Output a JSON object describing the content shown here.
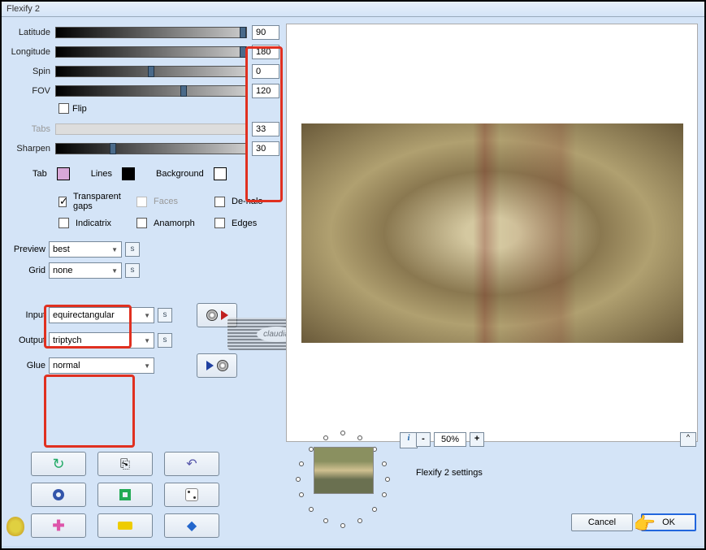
{
  "window": {
    "title": "Flexify 2"
  },
  "sliders": {
    "latitude": {
      "label": "Latitude",
      "value": "90",
      "thumb_pct": 100
    },
    "longitude": {
      "label": "Longitude",
      "value": "180",
      "thumb_pct": 100
    },
    "spin": {
      "label": "Spin",
      "value": "0",
      "thumb_pct": 50
    },
    "fov": {
      "label": "FOV",
      "value": "120",
      "thumb_pct": 67
    },
    "tabs": {
      "label": "Tabs",
      "value": "33",
      "thumb_pct": 33,
      "disabled": true
    },
    "sharpen": {
      "label": "Sharpen",
      "value": "30",
      "thumb_pct": 30
    }
  },
  "flip": {
    "label": "Flip",
    "checked": false
  },
  "colors": {
    "tab": {
      "label": "Tab",
      "hex": "#d8a8d8"
    },
    "lines": {
      "label": "Lines",
      "hex": "#000000"
    },
    "background": {
      "label": "Background",
      "hex": "#ffffff"
    }
  },
  "checks": {
    "transparent_gaps": {
      "label": "Transparent gaps",
      "checked": true
    },
    "faces": {
      "label": "Faces",
      "checked": false,
      "disabled": true
    },
    "dehalo": {
      "label": "De-halo",
      "checked": false
    },
    "indicatrix": {
      "label": "Indicatrix",
      "checked": false
    },
    "anamorph": {
      "label": "Anamorph",
      "checked": false
    },
    "edges": {
      "label": "Edges",
      "checked": false
    }
  },
  "dropdowns": {
    "preview": {
      "label": "Preview",
      "value": "best"
    },
    "grid": {
      "label": "Grid",
      "value": "none"
    },
    "input": {
      "label": "Input",
      "value": "equirectangular"
    },
    "output": {
      "label": "Output",
      "value": "triptych"
    },
    "glue": {
      "label": "Glue",
      "value": "normal"
    }
  },
  "mini_btn": "s",
  "zoom": {
    "value": "50%",
    "minus": "-",
    "plus": "+"
  },
  "info_btn": "i",
  "expand_btn": "^",
  "settings_text": "Flexify 2 settings",
  "buttons": {
    "cancel": "Cancel",
    "ok": "OK"
  },
  "watermark": "claudia",
  "tool_icons": {
    "reset": "reset-icon",
    "copy": "copy-icon",
    "undo": "undo-icon",
    "ring": "ring-icon",
    "square": "square-icon",
    "dice": "dice-icon",
    "plus": "plus-pink-icon",
    "brick": "brick-icon",
    "gem": "gem-icon"
  }
}
